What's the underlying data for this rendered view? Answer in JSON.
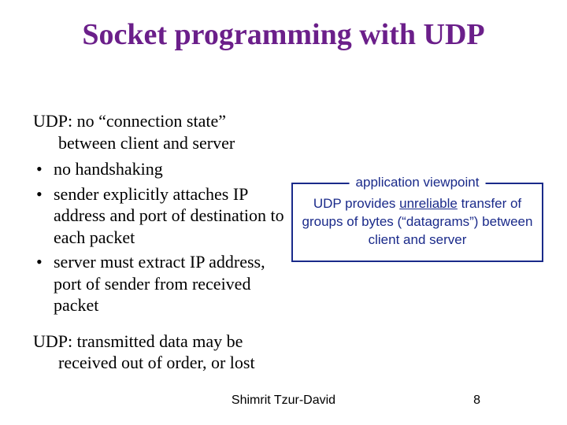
{
  "title": "Socket programming with UDP",
  "left": {
    "intro_line1": "UDP: no “connection state”",
    "intro_line2": "between client and server",
    "bullets": [
      "no handshaking",
      "sender explicitly attaches IP address and port of destination to each packet",
      "server must extract IP address, port of sender from received packet"
    ],
    "closing_line1": "UDP: transmitted data may be",
    "closing_line2": "received out of order, or lost"
  },
  "box": {
    "legend": "application viewpoint",
    "text_pre": "UDP provides ",
    "text_underline": "unreliable",
    "text_post": " transfer of groups of bytes (“datagrams”) between client and server"
  },
  "footer": {
    "author": "Shimrit Tzur-David",
    "page": "8"
  }
}
